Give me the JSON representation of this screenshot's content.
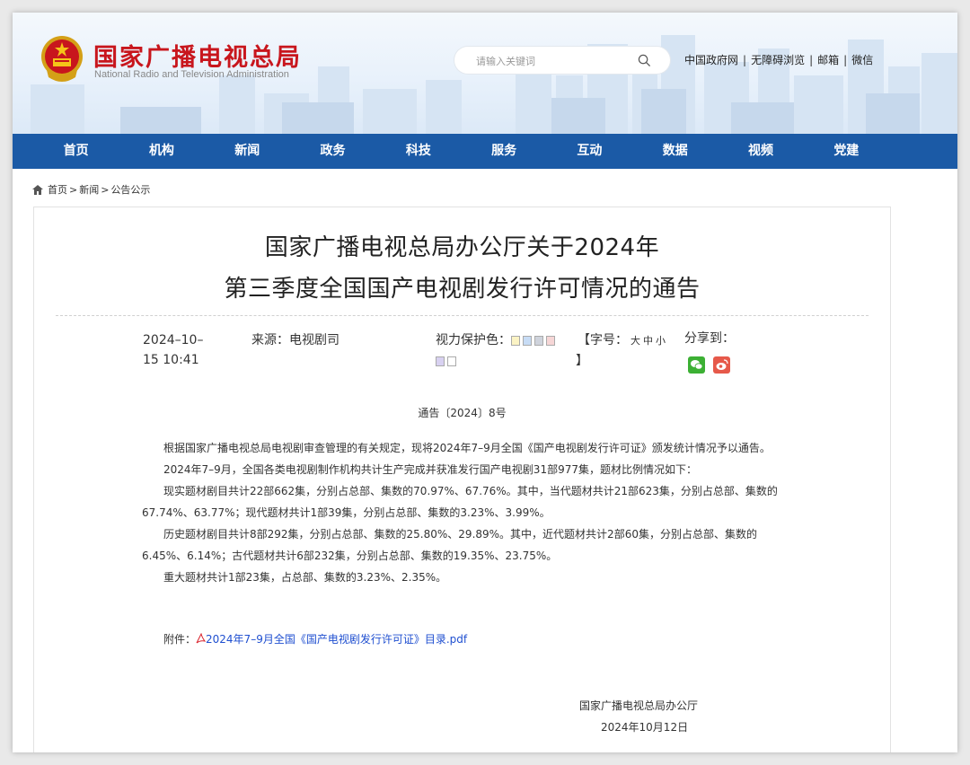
{
  "header": {
    "title": "国家广播电视总局",
    "subtitle": "National Radio and Television Administration",
    "search_placeholder": "请输入关键词",
    "toplinks": [
      "中国政府网",
      "无障碍浏览",
      "邮箱",
      "微信"
    ],
    "separator": "|"
  },
  "nav": [
    "首页",
    "机构",
    "新闻",
    "政务",
    "科技",
    "服务",
    "互动",
    "数据",
    "视频",
    "党建"
  ],
  "breadcrumb": {
    "items": [
      "首页",
      "新闻",
      "公告公示"
    ],
    "sep": ">"
  },
  "article": {
    "title_line1": "国家广播电视总局办公厅关于2024年",
    "title_line2": "第三季度全国国产电视剧发行许可情况的通告",
    "date_line1": "2024–10–",
    "date_line2": "15 10:41",
    "source": "来源：电视剧司",
    "eye_label": "视力保护色：",
    "font_label": "【字号：",
    "font_sizes": [
      "大",
      "中",
      "小"
    ],
    "font_close": "】",
    "share_label": "分享到：",
    "doc_number": "通告〔2024〕8号",
    "paragraphs": [
      "根据国家广播电视总局电视剧审查管理的有关规定，现将2024年7–9月全国《国产电视剧发行许可证》颁发统计情况予以通告。",
      "2024年7–9月，全国各类电视剧制作机构共计生产完成并获准发行国产电视剧31部977集，题材比例情况如下：",
      "现实题材剧目共计22部662集，分别占总部、集数的70.97%、67.76%。其中，当代题材共计21部623集，分别占总部、集数的67.74%、63.77%；现代题材共计1部39集，分别占总部、集数的3.23%、3.99%。",
      "历史题材剧目共计8部292集，分别占总部、集数的25.80%、29.89%。其中，近代题材共计2部60集，分别占总部、集数的6.45%、6.14%；古代题材共计6部232集，分别占总部、集数的19.35%、23.75%。",
      "重大题材共计1部23集，占总部、集数的3.23%、2.35%。"
    ],
    "attachment_label": "附件：",
    "attachment_link": "2024年7–9月全国《国产电视剧发行许可证》目录.pdf",
    "sign_org": "国家广播电视总局办公厅",
    "sign_date": "2024年10月12日"
  },
  "colors": {
    "brand_red": "#c8161d",
    "nav_blue": "#1b5aa6",
    "link_blue": "#1f4fd0",
    "swatches": [
      "#fbf3c4",
      "#c7dcf5",
      "#cfd3dc",
      "#f6d6d6",
      "#d8d1f1",
      "#ffffff"
    ]
  }
}
